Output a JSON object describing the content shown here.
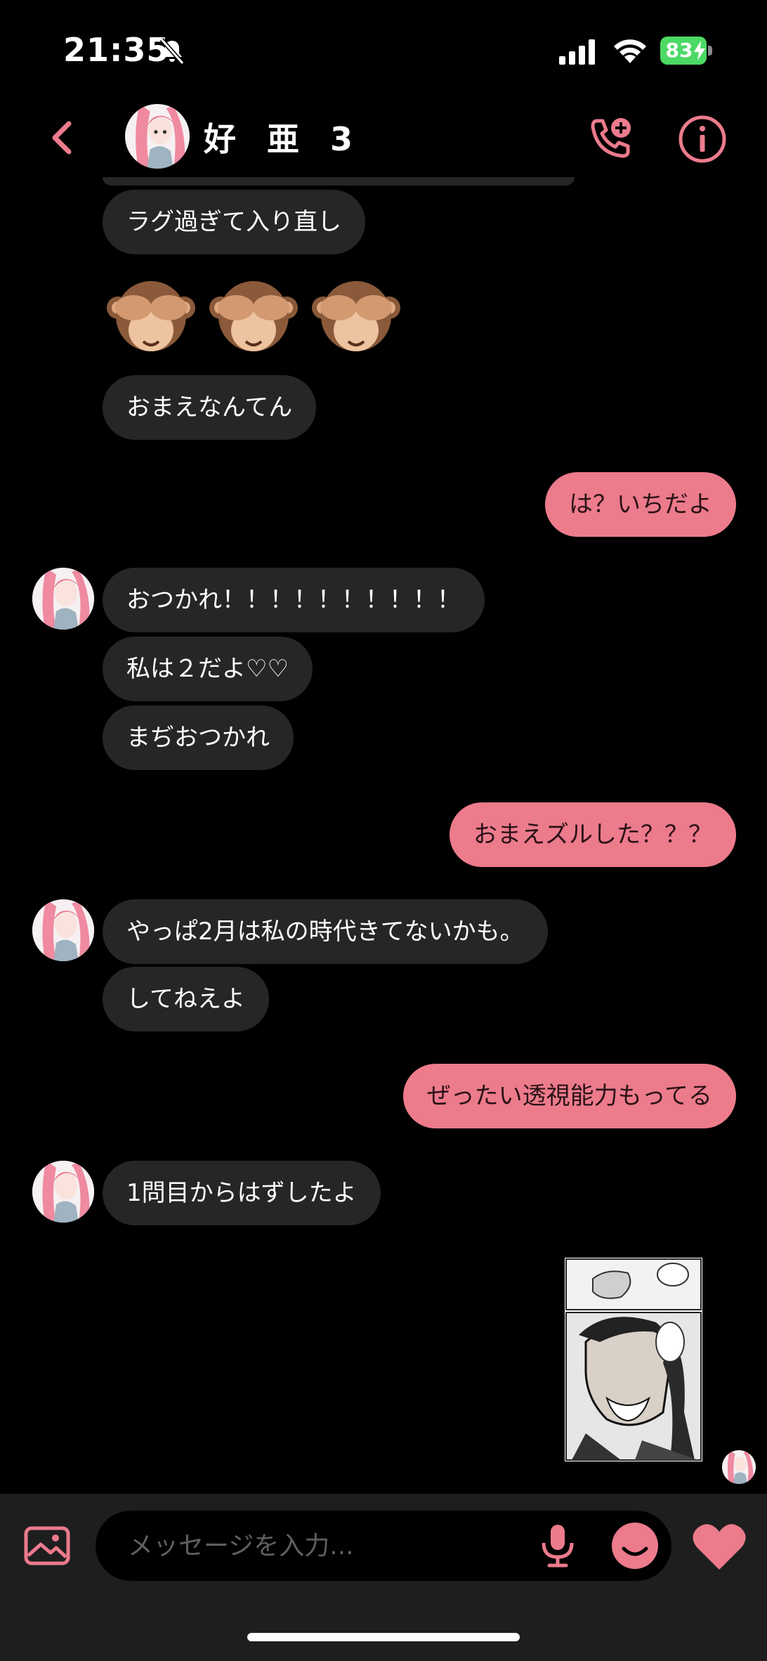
{
  "status_bar": {
    "time": "21:35",
    "battery": "83"
  },
  "header": {
    "name": "好 亜 3"
  },
  "colors": {
    "accent": "#ec7b8c",
    "incoming_bubble": "#262628",
    "background": "#000000",
    "battery": "#4cd964"
  },
  "icons": {
    "back": "chevron-left-icon",
    "call": "phone-plus-icon",
    "info": "info-icon",
    "gallery": "image-icon",
    "mic": "microphone-icon",
    "sticker": "smiley-icon",
    "like": "heart-icon"
  },
  "messages": [
    {
      "side": "in",
      "text": "ラグ過ぎて入り直し"
    },
    {
      "side": "in",
      "text": "🙈🙈🙈"
    },
    {
      "side": "in",
      "text": "おまえなんてん"
    },
    {
      "side": "out",
      "text": "は？いちだよ"
    },
    {
      "side": "in",
      "text": "おつかれ！！！！！！！！！！"
    },
    {
      "side": "in",
      "text": "私は２だよ♡♡"
    },
    {
      "side": "in",
      "text": "まぢおつかれ"
    },
    {
      "side": "out",
      "text": "おまえズルした？？？"
    },
    {
      "side": "in",
      "text": "やっぱ2月は私の時代きてないかも。"
    },
    {
      "side": "in",
      "text": "してねえよ"
    },
    {
      "side": "out",
      "text": "ぜったい透視能力もってる"
    },
    {
      "side": "in",
      "text": "1問目からはずしたよ"
    },
    {
      "side": "out",
      "text": "[manga image]"
    }
  ],
  "composer": {
    "placeholder": "メッセージを入力..."
  }
}
